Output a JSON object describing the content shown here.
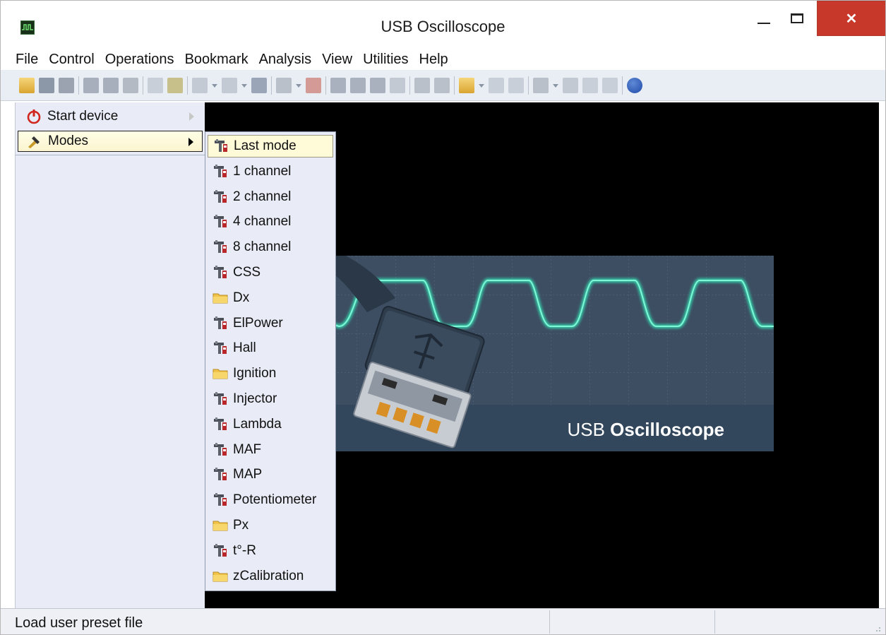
{
  "window": {
    "title": "USB Oscilloscope",
    "close_glyph": "✕"
  },
  "menu": [
    "File",
    "Control",
    "Operations",
    "Bookmark",
    "Analysis",
    "View",
    "Utilities",
    "Help"
  ],
  "sidebar": {
    "items": [
      {
        "label": "Start device",
        "icon": "power-icon"
      },
      {
        "label": "Modes",
        "icon": "modes-icon",
        "selected": true
      }
    ]
  },
  "submenu": {
    "items": [
      {
        "label": "Last mode",
        "icon": "probe-icon",
        "selected": true
      },
      {
        "label": "1 channel",
        "icon": "probe-icon"
      },
      {
        "label": "2 channel",
        "icon": "probe-icon"
      },
      {
        "label": "4 channel",
        "icon": "probe-icon"
      },
      {
        "label": "8 channel",
        "icon": "probe-icon"
      },
      {
        "label": "CSS",
        "icon": "probe-icon"
      },
      {
        "label": "Dx",
        "icon": "folder-icon"
      },
      {
        "label": "ElPower",
        "icon": "probe-icon"
      },
      {
        "label": "Hall",
        "icon": "probe-icon"
      },
      {
        "label": "Ignition",
        "icon": "folder-icon"
      },
      {
        "label": "Injector",
        "icon": "probe-icon"
      },
      {
        "label": "Lambda",
        "icon": "probe-icon"
      },
      {
        "label": "MAF",
        "icon": "probe-icon"
      },
      {
        "label": "MAP",
        "icon": "probe-icon"
      },
      {
        "label": "Potentiometer",
        "icon": "probe-icon"
      },
      {
        "label": "Px",
        "icon": "folder-icon"
      },
      {
        "label": "t°-R",
        "icon": "probe-icon"
      },
      {
        "label": "zCalibration",
        "icon": "folder-icon"
      }
    ]
  },
  "splash": {
    "text_light": "USB",
    "text_bold": "Oscilloscope"
  },
  "statusbar": {
    "text": "Load user preset file"
  },
  "colors": {
    "sidebar_bg": "#e9ecf7",
    "trace": "#32e3b6",
    "close_button": "#c7372a"
  }
}
